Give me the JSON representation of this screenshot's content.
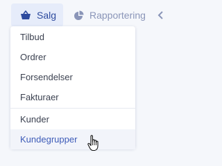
{
  "nav": {
    "sales_label": "Salg",
    "sales_icon": "basket-icon",
    "reporting_label": "Rapportering",
    "reporting_icon": "pie-chart-icon",
    "next_icon": "arrow-icon"
  },
  "dropdown": {
    "items": [
      {
        "label": "Tilbud"
      },
      {
        "label": "Ordrer"
      },
      {
        "label": "Forsendelser"
      },
      {
        "label": "Fakturaer"
      },
      {
        "label": "Kunder"
      },
      {
        "label": "Kundegrupper"
      }
    ],
    "active_item": "Kundegrupper"
  },
  "colors": {
    "accent": "#2d4a9e",
    "active_bg": "#e6ecfa",
    "muted": "#8a95b8"
  }
}
